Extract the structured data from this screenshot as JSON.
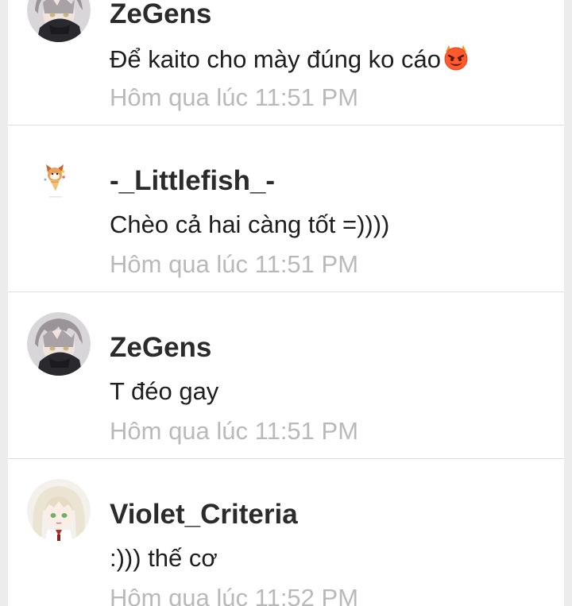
{
  "comments": [
    {
      "author": "ZeGens",
      "message": "Để kaito cho mày đúng ko cáo",
      "emoji": "smiling-devil-icon",
      "time": "Hôm qua lúc 11:51 PM"
    },
    {
      "author": "-_Littlefish_-",
      "message": "Chèo cả hai càng tốt =))))",
      "time": "Hôm qua lúc 11:51 PM"
    },
    {
      "author": "ZeGens",
      "message": "T đéo gay",
      "time": "Hôm qua lúc 11:51 PM"
    },
    {
      "author": "Violet_Criteria",
      "message": ":))) thế cơ",
      "time": "Hôm qua lúc 11:52 PM"
    }
  ],
  "colors": {
    "background": "#ececec",
    "panel": "#ffffff",
    "name": "#2b2b2b",
    "timestamp": "#b9b9b9",
    "divider": "#dedede"
  }
}
